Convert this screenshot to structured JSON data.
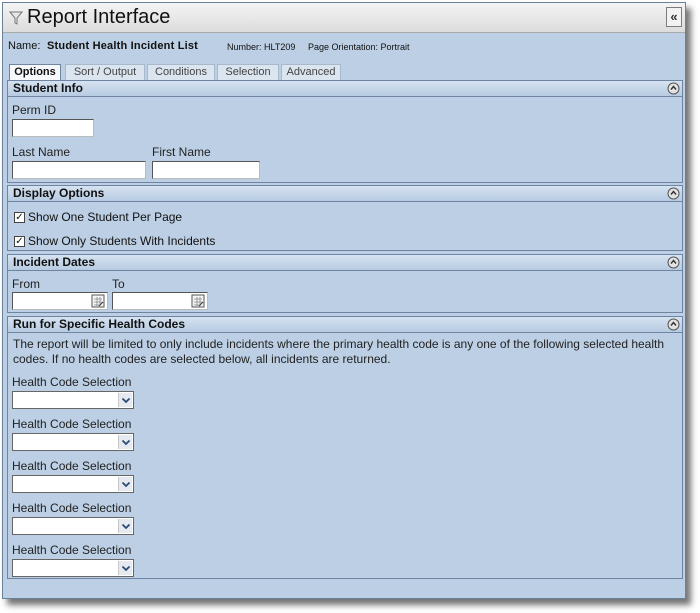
{
  "window": {
    "title": "Report Interface",
    "collapse_label": "«"
  },
  "report": {
    "name_label": "Name:",
    "name": "Student Health Incident List",
    "number_text": "Number: HLT209",
    "orientation_text": "Page Orientation: Portrait"
  },
  "tabs": [
    {
      "label": "Options",
      "active": true
    },
    {
      "label": "Sort / Output",
      "active": false
    },
    {
      "label": "Conditions",
      "active": false
    },
    {
      "label": "Selection",
      "active": false
    },
    {
      "label": "Advanced",
      "active": false
    }
  ],
  "student_info": {
    "header": "Student Info",
    "perm_id_label": "Perm ID",
    "perm_id_value": "",
    "last_name_label": "Last Name",
    "last_name_value": "",
    "first_name_label": "First Name",
    "first_name_value": ""
  },
  "display_options": {
    "header": "Display Options",
    "items": [
      {
        "label": "Show One Student Per Page",
        "checked": true
      },
      {
        "label": "Show Only Students With Incidents",
        "checked": true
      }
    ]
  },
  "incident_dates": {
    "header": "Incident Dates",
    "from_label": "From",
    "from_value": "",
    "to_label": "To",
    "to_value": ""
  },
  "health_codes": {
    "header": "Run for Specific Health Codes",
    "description": "The report will be limited to only include incidents where the primary health code is any one of the following selected health codes. If no health codes are selected below, all incidents are returned.",
    "selections": [
      {
        "label": "Health Code Selection",
        "value": ""
      },
      {
        "label": "Health Code Selection",
        "value": ""
      },
      {
        "label": "Health Code Selection",
        "value": ""
      },
      {
        "label": "Health Code Selection",
        "value": ""
      },
      {
        "label": "Health Code Selection",
        "value": ""
      }
    ]
  },
  "colors": {
    "panel": "#bccfe4",
    "header": "#c9d9eb",
    "border": "#6f84a0"
  }
}
